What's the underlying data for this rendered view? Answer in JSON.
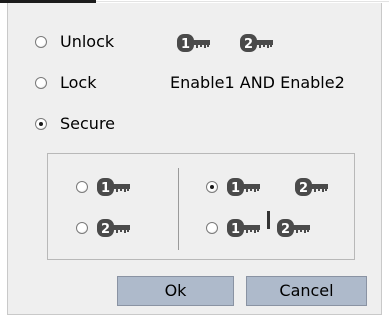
{
  "modes": [
    {
      "label": "Unlock",
      "checked": false
    },
    {
      "label": "Lock",
      "checked": false
    },
    {
      "label": "Secure",
      "checked": true
    }
  ],
  "enable_condition": "Enable1 AND Enable2",
  "icons": {
    "key1": {
      "number": "1",
      "name": "key-1-icon"
    },
    "key2": {
      "number": "2",
      "name": "key-2-icon"
    }
  },
  "secure_options": {
    "left": [
      {
        "keys": "key1",
        "checked": false
      },
      {
        "keys": "key2",
        "checked": false
      }
    ],
    "right": [
      {
        "keys": "key1 + key2",
        "checked": true
      },
      {
        "keys": "key1 | key2",
        "checked": false
      }
    ],
    "or_separator": "|"
  },
  "buttons": {
    "ok": "Ok",
    "cancel": "Cancel"
  },
  "colors": {
    "panel": "#efefef",
    "button": "#aebacb",
    "key": "#4a4a4a"
  }
}
